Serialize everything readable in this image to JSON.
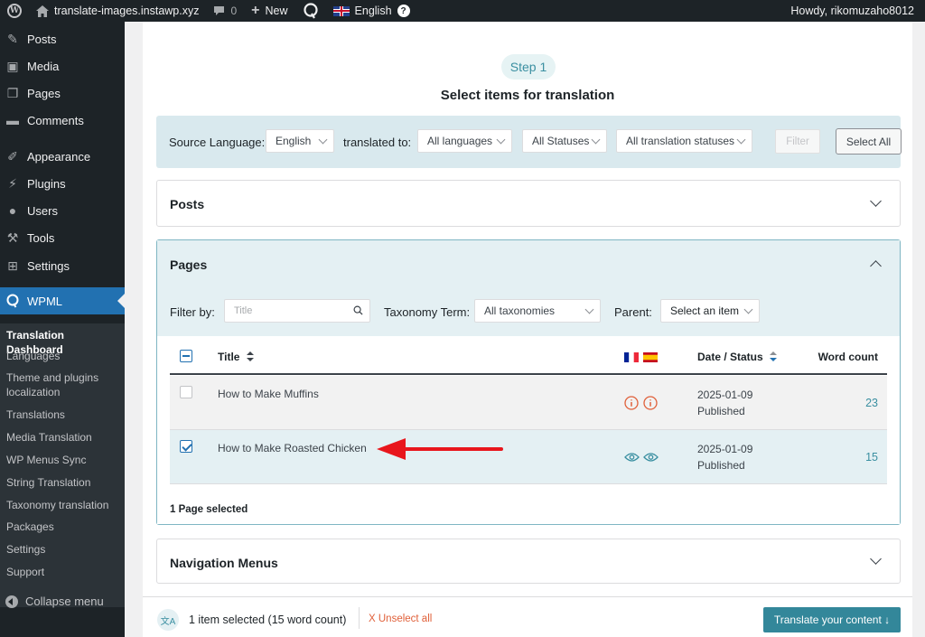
{
  "adminbar": {
    "site_name": "translate-images.instawp.xyz",
    "comments_count": "0",
    "new_label": "New",
    "language": "English",
    "howdy": "Howdy, rikomuzaho8012"
  },
  "sidebar": {
    "items": [
      {
        "label": "Posts",
        "icon": "pushpin-icon"
      },
      {
        "label": "Media",
        "icon": "media-icon"
      },
      {
        "label": "Pages",
        "icon": "pages-icon"
      },
      {
        "label": "Comments",
        "icon": "comment-icon"
      },
      {
        "label": "Appearance",
        "icon": "brush-icon"
      },
      {
        "label": "Plugins",
        "icon": "plug-icon"
      },
      {
        "label": "Users",
        "icon": "user-icon"
      },
      {
        "label": "Tools",
        "icon": "wrench-icon"
      },
      {
        "label": "Settings",
        "icon": "settings-icon"
      }
    ],
    "wpml_label": "WPML",
    "submenu": [
      "Translation Dashboard",
      "Languages",
      "Theme and plugins localization",
      "Translations",
      "Media Translation",
      "WP Menus Sync",
      "String Translation",
      "Taxonomy translation",
      "Packages",
      "Settings",
      "Support"
    ],
    "collapse_label": "Collapse menu"
  },
  "main": {
    "step_label": "Step 1",
    "title": "Select items for translation",
    "filters": {
      "source_language_label": "Source Language:",
      "source_language_value": "English",
      "translated_to_label": "translated to:",
      "translated_to_value": "All languages",
      "status_value": "All Statuses",
      "translation_status_value": "All translation statuses",
      "filter_button": "Filter",
      "select_all_button": "Select All"
    },
    "posts_section": {
      "title": "Posts"
    },
    "pages_section": {
      "title": "Pages",
      "filter_by_label": "Filter by:",
      "title_placeholder": "Title",
      "taxonomy_label": "Taxonomy Term:",
      "taxonomy_value": "All taxonomies",
      "parent_label": "Parent:",
      "parent_value": "Select an item",
      "columns": {
        "title": "Title",
        "date_status": "Date / Status",
        "word_count": "Word count"
      },
      "rows": [
        {
          "title": "How to Make Muffins",
          "date": "2025-01-09",
          "status": "Published",
          "word_count": "23",
          "checked": false,
          "translation_icon": "info-icon"
        },
        {
          "title": "How to Make Roasted Chicken",
          "date": "2025-01-09",
          "status": "Published",
          "word_count": "15",
          "checked": true,
          "translation_icon": "eye-icon"
        }
      ],
      "selected_summary": "1 Page selected"
    },
    "nav_menus_section": {
      "title": "Navigation Menus"
    }
  },
  "bottom_bar": {
    "selection_summary": "1 item selected (15 word count)",
    "unselect_all": "X Unselect all",
    "translate_button": "Translate your content ↓"
  },
  "colors": {
    "accent": "#33879a",
    "filterbar_bg": "#d9e9ee",
    "wp_blue": "#2271b1",
    "arrow_red": "#e8161c",
    "warning_orange": "#e0603a"
  }
}
